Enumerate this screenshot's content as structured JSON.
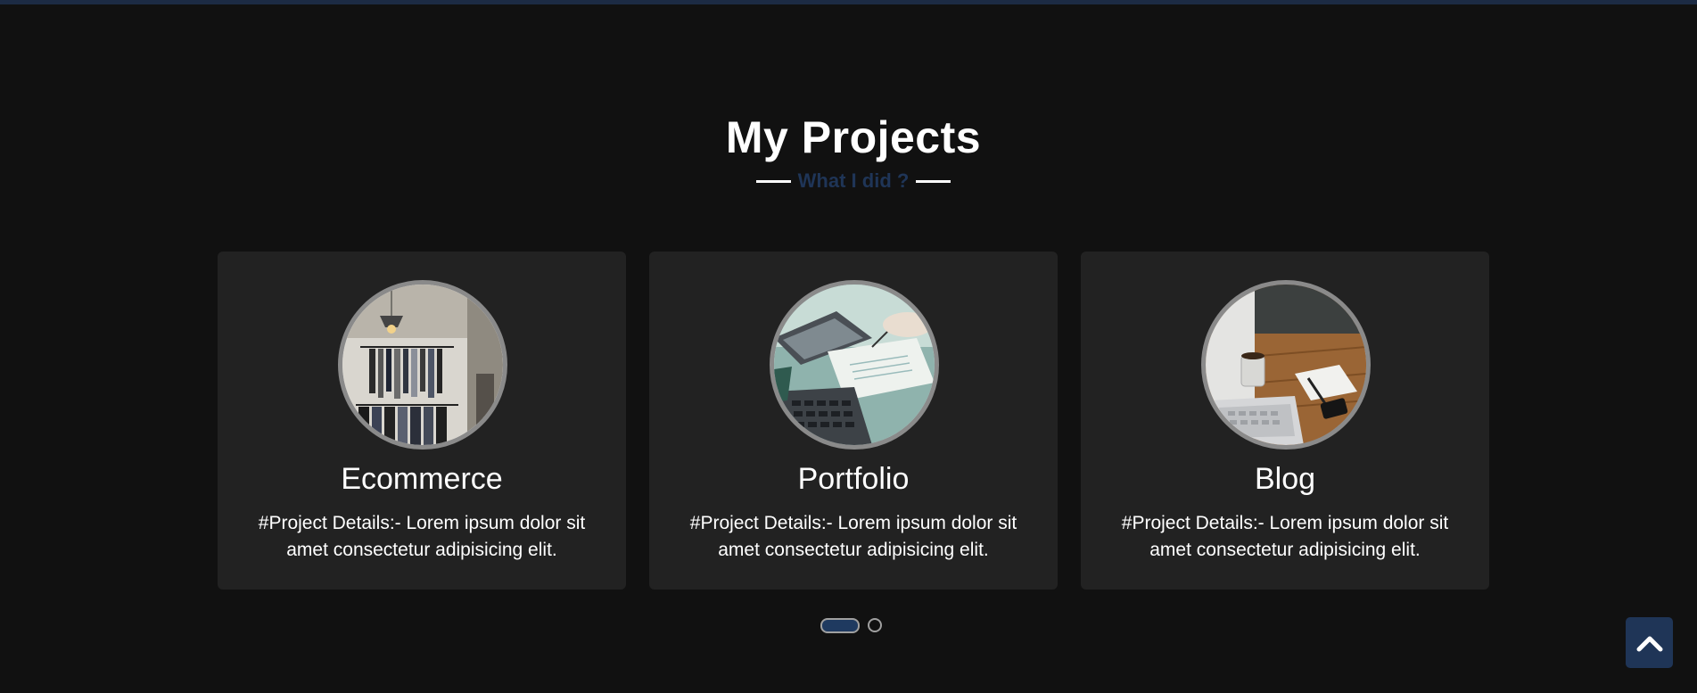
{
  "section": {
    "title": "My Projects",
    "subtitle": "What I did ?"
  },
  "projects": [
    {
      "title": "Ecommerce",
      "description": "#Project Details:- Lorem ipsum dolor sit amet consectetur adipisicing elit.",
      "image_icon": "clothing-store-photo"
    },
    {
      "title": "Portfolio",
      "description": "#Project Details:- Lorem ipsum dolor sit amet consectetur adipisicing elit.",
      "image_icon": "laptop-desk-photo"
    },
    {
      "title": "Blog",
      "description": "#Project Details:- Lorem ipsum dolor sit amet consectetur adipisicing elit.",
      "image_icon": "workspace-coffee-photo"
    }
  ],
  "carousel": {
    "active_index": 0,
    "page_count": 2
  },
  "scroll_top": {
    "icon": "chevron-up-icon"
  },
  "colors": {
    "background": "#111111",
    "card": "#222222",
    "accent": "#1f3557"
  }
}
